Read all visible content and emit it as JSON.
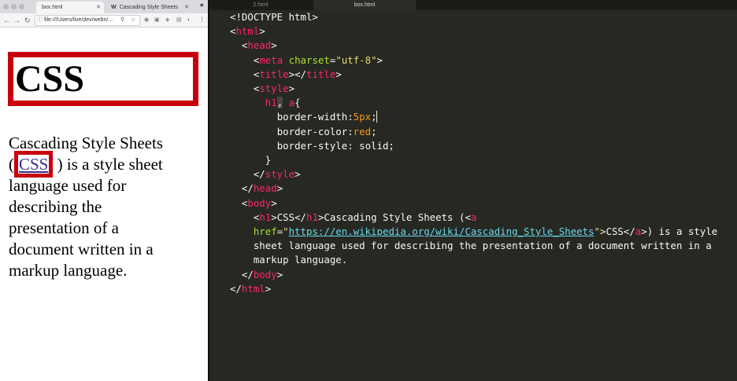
{
  "browser": {
    "tabs": [
      {
        "title": "box.html",
        "active": true
      },
      {
        "title": "Cascading Style Sheets",
        "favicon": "W",
        "active": false
      }
    ],
    "url": "file:///Users/live/dev/webn/...",
    "page": {
      "heading": "CSS",
      "text_lines": [
        "Cascading Style Sheets",
        ") is a style sheet",
        "language used for",
        "describing the",
        "presentation of a",
        "document written in a",
        "markup language."
      ],
      "open_paren": "(",
      "link_text": "CSS"
    }
  },
  "editor": {
    "tabs": [
      {
        "title": "2.html",
        "active": false
      },
      {
        "title": "box.html",
        "active": true
      }
    ],
    "code": {
      "doctype": "<!DOCTYPE html>",
      "html_open": "html",
      "head_open": "head",
      "meta_tag": "meta",
      "meta_attr": "charset",
      "meta_value": "\"utf-8\"",
      "title_tag": "title",
      "style_tag": "style",
      "sel_h1": "h1",
      "sel_a": "a",
      "decl1_prop": "border-width:",
      "decl1_value": "5px",
      "decl2_prop": "border-color:",
      "decl2_value": "red",
      "decl3_prop": "border-style: solid;",
      "head_close": "head",
      "body_open": "body",
      "h1_tag": "h1",
      "h1_text": "CSS",
      "body_text1": "Cascading Style Sheets (",
      "a_tag": "a",
      "href_attr": "href",
      "href_value": "https://en.wikipedia.org/wiki/Cascading_Style_Sheets",
      "a_text": "CSS",
      "body_text2": ") is a style",
      "body_text3": "sheet language used for describing the presentation of a document written in a",
      "body_text4": "markup language.",
      "body_close": "body",
      "html_close": "html"
    }
  },
  "colors": {
    "border_red": "#c8000e",
    "editor_bg": "#272822",
    "tag": "#f92672",
    "attr": "#a6e22e",
    "string": "#e6db74",
    "number": "#fd971f"
  }
}
